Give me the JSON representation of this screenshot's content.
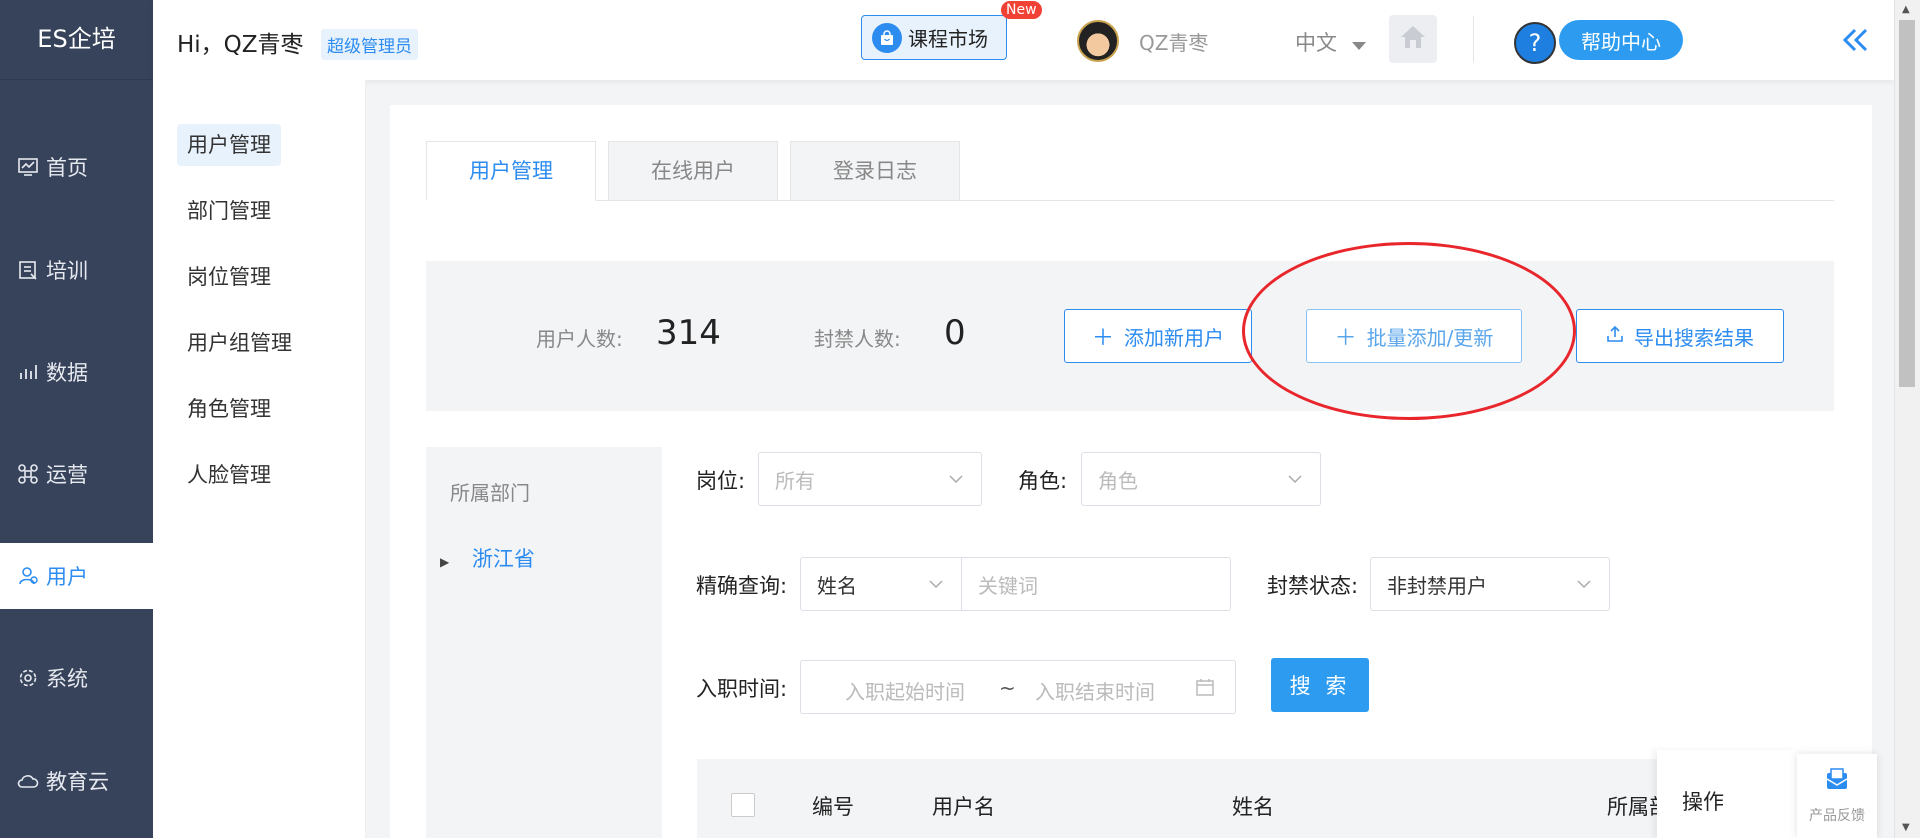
{
  "app": {
    "logo": "ES企培"
  },
  "leftnav": {
    "items": [
      {
        "label": "首页",
        "icon": "monitor-chart-icon"
      },
      {
        "label": "培训",
        "icon": "book-icon"
      },
      {
        "label": "数据",
        "icon": "bar-chart-icon"
      },
      {
        "label": "运营",
        "icon": "command-icon"
      },
      {
        "label": "用户",
        "icon": "user-icon",
        "active": true
      },
      {
        "label": "系统",
        "icon": "gear-icon"
      },
      {
        "label": "教育云",
        "icon": "cloud-icon"
      }
    ]
  },
  "subnav": {
    "items": [
      {
        "label": "用户管理",
        "active": true
      },
      {
        "label": "部门管理"
      },
      {
        "label": "岗位管理"
      },
      {
        "label": "用户组管理"
      },
      {
        "label": "角色管理"
      },
      {
        "label": "人脸管理"
      }
    ]
  },
  "topbar": {
    "greeting": "Hi，QZ青枣",
    "role_badge": "超级管理员",
    "market_label": "课程市场",
    "new_tag": "New",
    "username": "QZ青枣",
    "language": "中文",
    "help_label": "帮助中心"
  },
  "tabs": [
    {
      "label": "用户管理",
      "active": true
    },
    {
      "label": "在线用户"
    },
    {
      "label": "登录日志"
    }
  ],
  "stats": {
    "users_label": "用户人数:",
    "users_value": "314",
    "banned_label": "封禁人数:",
    "banned_value": "0"
  },
  "actions": {
    "add_user": "添加新用户",
    "batch_add": "批量添加/更新",
    "export": "导出搜索结果"
  },
  "dept": {
    "title": "所属部门",
    "node": "浙江省"
  },
  "filters": {
    "position_label": "岗位:",
    "position_value": "所有",
    "role_label": "角色:",
    "role_placeholder": "角色",
    "exact_label": "精确查询:",
    "exact_field": "姓名",
    "keyword_placeholder": "关键词",
    "ban_label": "封禁状态:",
    "ban_value": "非封禁用户",
    "hire_label": "入职时间:",
    "hire_start": "入职起始时间",
    "hire_sep": "~",
    "hire_end": "入职结束时间",
    "search_button": "搜 索"
  },
  "table": {
    "columns": [
      "编号",
      "用户名",
      "姓名",
      "所属部",
      "操作"
    ]
  },
  "feedback": {
    "label": "产品反馈"
  },
  "colors": {
    "accent": "#2d8cf0",
    "nav_bg": "#37435a",
    "highlight": "#e8262b"
  }
}
